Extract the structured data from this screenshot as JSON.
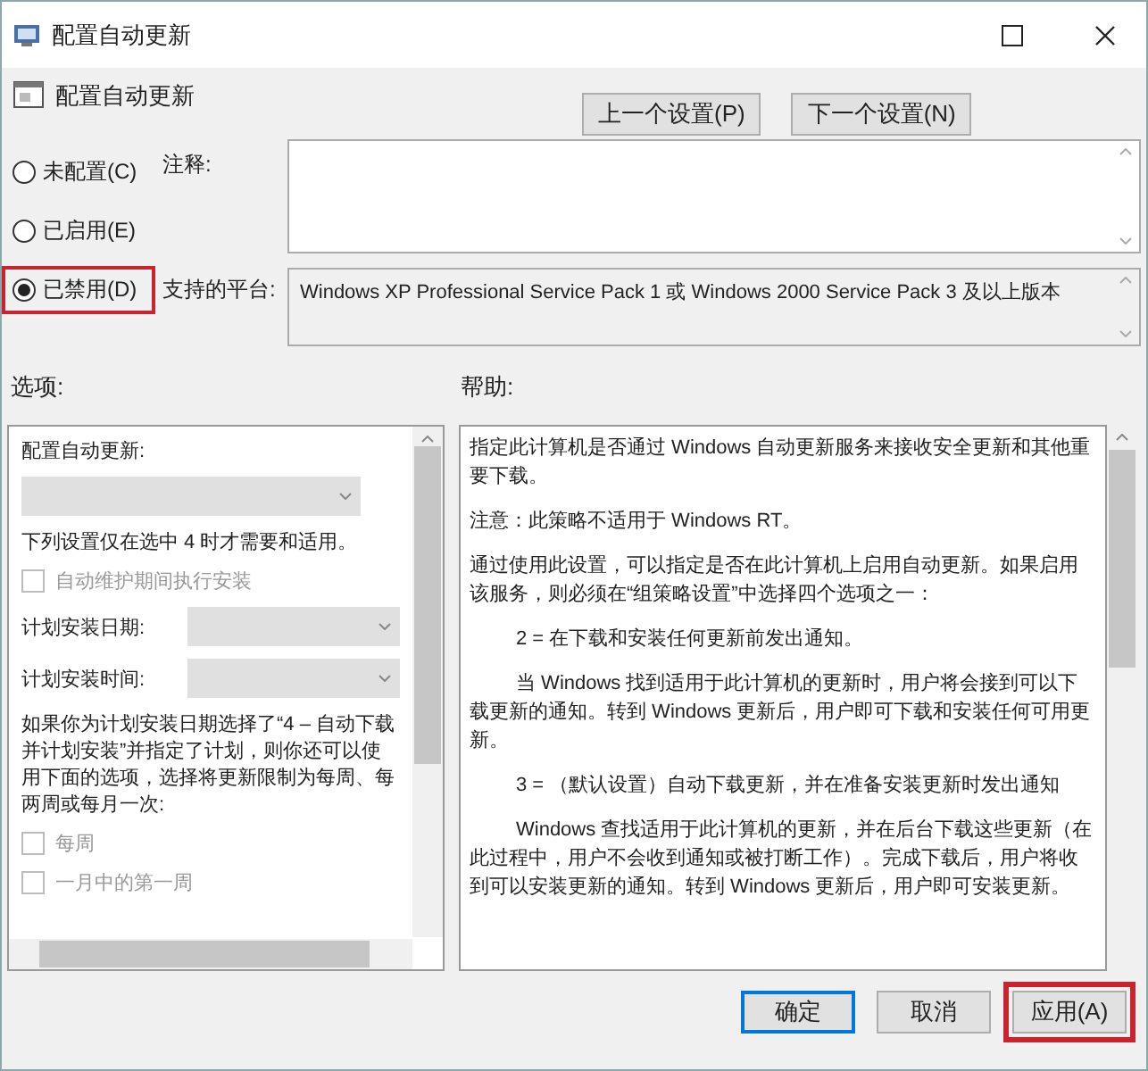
{
  "window": {
    "title": "配置自动更新"
  },
  "policy": {
    "title": "配置自动更新"
  },
  "nav_buttons": [
    {
      "label": "上一个设置(P)"
    },
    {
      "label": "下一个设置(N)"
    }
  ],
  "state_options": [
    {
      "label": "未配置(C)",
      "selected": false,
      "highlighted": false
    },
    {
      "label": "已启用(E)",
      "selected": false,
      "highlighted": false
    },
    {
      "label": "已禁用(D)",
      "selected": true,
      "highlighted": true
    }
  ],
  "comment": {
    "label": "注释:"
  },
  "platform": {
    "label": "支持的平台:",
    "value": "Windows XP Professional Service Pack 1 或 Windows 2000 Service Pack 3 及以上版本"
  },
  "options": {
    "label": "选项:",
    "items": [
      {
        "kind": "text",
        "text": "配置自动更新:"
      },
      {
        "kind": "dropdown"
      },
      {
        "kind": "text",
        "text": "下列设置仅在选中 4 时才需要和适用。"
      },
      {
        "kind": "checkbox",
        "label": "自动维护期间执行安装",
        "checked": false,
        "disabled": true
      },
      {
        "kind": "dropdown-row",
        "label": "计划安装日期:"
      },
      {
        "kind": "dropdown-row",
        "label": "计划安装时间:"
      },
      {
        "kind": "text",
        "text": "如果你为计划安装日期选择了“4 – 自动下载并计划安装”并指定了计划，则你还可以使用下面的选项，选择将更新限制为每周、每两周或每月一次:"
      },
      {
        "kind": "checkbox",
        "label": "每周",
        "checked": false,
        "disabled": true
      },
      {
        "kind": "checkbox",
        "label": "一月中的第一周",
        "checked": false,
        "disabled": true
      }
    ]
  },
  "help": {
    "label": "帮助:",
    "paragraphs": [
      {
        "kind": "plain",
        "text": "指定此计算机是否通过 Windows 自动更新服务来接收安全更新和其他重要下载。"
      },
      {
        "kind": "plain",
        "text": "注意：此策略不适用于 Windows RT。"
      },
      {
        "kind": "plain",
        "text": "通过使用此设置，可以指定是否在此计算机上启用自动更新。如果启用该服务，则必须在“组策略设置”中选择四个选项之一："
      },
      {
        "kind": "indented",
        "text": "2 = 在下载和安装任何更新前发出通知。"
      },
      {
        "kind": "indented",
        "text": "当 Windows 找到适用于此计算机的更新时，用户将会接到可以下载更新的通知。转到 Windows 更新后，用户即可下载和安装任何可用更新。"
      },
      {
        "kind": "indented",
        "text": "3 = （默认设置）自动下载更新，并在准备安装更新时发出通知"
      },
      {
        "kind": "indented",
        "text": "Windows 查找适用于此计算机的更新，并在后台下载这些更新（在此过程中，用户不会收到通知或被打断工作）。完成下载后，用户将收到可以安装更新的通知。转到 Windows 更新后，用户即可安装更新。"
      }
    ]
  },
  "dialog_buttons": [
    {
      "label": "确定",
      "default": true,
      "highlighted": false
    },
    {
      "label": "取消",
      "default": false,
      "highlighted": false
    },
    {
      "label": "应用(A)",
      "default": false,
      "highlighted": true
    }
  ]
}
